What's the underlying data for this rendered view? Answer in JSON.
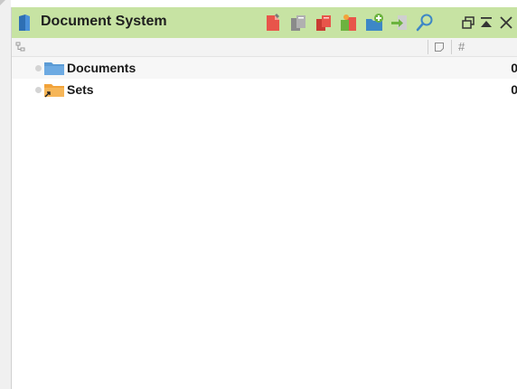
{
  "window": {
    "title": "Document System",
    "title_icon": "document-blue-icon"
  },
  "toolbar": {
    "icons": [
      "new-document-icon",
      "copy-documents-icon",
      "duplicate-documents-icon",
      "import-documents-icon",
      "new-folder-icon",
      "export-icon",
      "search-icon"
    ]
  },
  "window_controls": [
    "float-panel-icon",
    "minimize-panel-icon",
    "close-panel-icon"
  ],
  "columns": {
    "tree_icon": "hierarchy-icon",
    "memo_icon": "memo-column-icon",
    "count_symbol": "#"
  },
  "tree": {
    "items": [
      {
        "label": "Documents",
        "count": "0",
        "icon": "blue-folder-icon",
        "color": "#5b9bd5"
      },
      {
        "label": "Sets",
        "count": "0",
        "icon": "orange-folder-link-icon",
        "color": "#f2a33a"
      }
    ]
  },
  "colors": {
    "titlebar": "#c7e3a3",
    "accent_red": "#e8554a",
    "accent_blue": "#3d87c6",
    "accent_green": "#6cb33f"
  }
}
